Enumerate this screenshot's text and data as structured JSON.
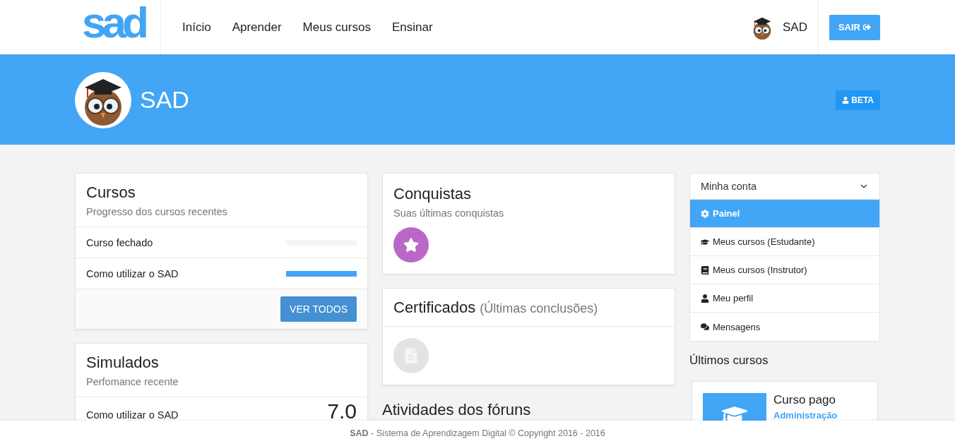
{
  "navbar": {
    "logo": "sad",
    "links": [
      "Início",
      "Aprender",
      "Meus cursos",
      "Ensinar"
    ],
    "user": "SAD",
    "logout": "SAIR"
  },
  "banner": {
    "name": "SAD",
    "badge": "BETA"
  },
  "cursos": {
    "title": "Cursos",
    "subtitle": "Progresso dos cursos recentes",
    "rows": [
      {
        "name": "Curso fechado",
        "level": 0
      },
      {
        "name": "Como utilizar o SAD",
        "level": 1
      }
    ],
    "button": "VER TODOS"
  },
  "simulados": {
    "title": "Simulados",
    "subtitle": "Perfomance recente",
    "rows": [
      {
        "name": "Como utilizar o SAD",
        "score": "7.0"
      }
    ]
  },
  "conquistas": {
    "title": "Conquistas",
    "subtitle": "Suas últimas conquistas"
  },
  "certificados": {
    "title": "Certificados",
    "subtitle": "(Últimas conclusões)"
  },
  "forum": {
    "title": "Atividades dos fóruns"
  },
  "account_menu": {
    "title": "Minha conta",
    "expanded": true,
    "items": [
      {
        "label": "Painel",
        "selected": true
      },
      {
        "label": "Meus cursos (Estudante)",
        "selected": false
      },
      {
        "label": "Meus cursos (Instrutor)",
        "selected": false
      },
      {
        "label": "Meu perfil",
        "selected": false
      },
      {
        "label": "Mensagens",
        "selected": false
      }
    ]
  },
  "latest_courses": {
    "title": "Últimos cursos",
    "items": [
      {
        "name": "Curso pago",
        "category": "Administração"
      }
    ]
  },
  "footer": {
    "brand": "SAD",
    "text": " - Sistema de Aprendizagem Digital © Copyright 2016 - 2016"
  }
}
